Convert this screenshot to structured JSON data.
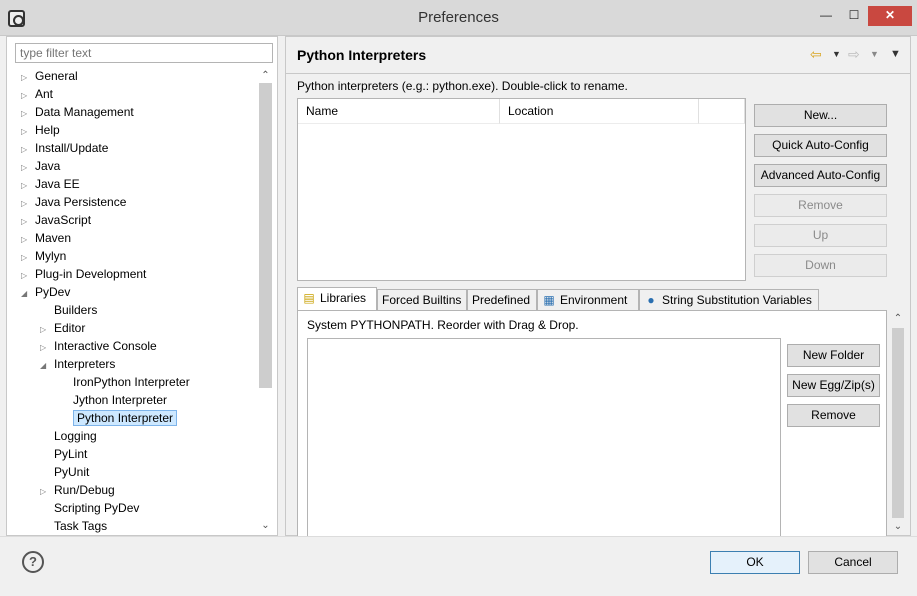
{
  "window": {
    "title": "Preferences",
    "icons": [
      "app-icon",
      "minimize-icon",
      "maximize-icon",
      "close-icon"
    ]
  },
  "filter": {
    "placeholder": "type filter text"
  },
  "tree": [
    {
      "label": "General",
      "expanded": false
    },
    {
      "label": "Ant",
      "expanded": false
    },
    {
      "label": "Data Management",
      "expanded": false
    },
    {
      "label": "Help",
      "expanded": false
    },
    {
      "label": "Install/Update",
      "expanded": false
    },
    {
      "label": "Java",
      "expanded": false
    },
    {
      "label": "Java EE",
      "expanded": false
    },
    {
      "label": "Java Persistence",
      "expanded": false
    },
    {
      "label": "JavaScript",
      "expanded": false
    },
    {
      "label": "Maven",
      "expanded": false
    },
    {
      "label": "Mylyn",
      "expanded": false
    },
    {
      "label": "Plug-in Development",
      "expanded": false
    },
    {
      "label": "PyDev",
      "expanded": true
    },
    {
      "label": "Builders"
    },
    {
      "label": "Editor",
      "expanded": false
    },
    {
      "label": "Interactive Console",
      "expanded": false
    },
    {
      "label": "Interpreters",
      "expanded": true
    },
    {
      "label": "IronPython Interpreter"
    },
    {
      "label": "Jython Interpreter"
    },
    {
      "label": "Python Interpreter",
      "selected": true
    },
    {
      "label": "Logging"
    },
    {
      "label": "PyLint"
    },
    {
      "label": "PyUnit"
    },
    {
      "label": "Run/Debug",
      "expanded": false
    },
    {
      "label": "Scripting PyDev"
    },
    {
      "label": "Task Tags"
    }
  ],
  "page": {
    "title": "Python Interpreters",
    "description": "Python interpreters (e.g.: python.exe).   Double-click to rename.",
    "table": {
      "columns": [
        "Name",
        "Location"
      ]
    },
    "buttons": {
      "new": "New...",
      "quick_auto_config": "Quick Auto-Config",
      "advanced_auto_config": "Advanced Auto-Config",
      "remove": "Remove",
      "up": "Up",
      "down": "Down"
    },
    "tabs": [
      {
        "label": "Libraries",
        "icon": "libraries-icon",
        "active": true
      },
      {
        "label": "Forced Builtins"
      },
      {
        "label": "Predefined"
      },
      {
        "label": "Environment",
        "icon": "environment-icon"
      },
      {
        "label": "String Substitution Variables",
        "icon": "variables-icon"
      }
    ],
    "libraries": {
      "description": "System PYTHONPATH.   Reorder with Drag & Drop.",
      "buttons": {
        "new_folder": "New Folder",
        "new_egg_zip": "New Egg/Zip(s)",
        "remove": "Remove"
      }
    }
  },
  "footer": {
    "ok": "OK",
    "cancel": "Cancel"
  }
}
